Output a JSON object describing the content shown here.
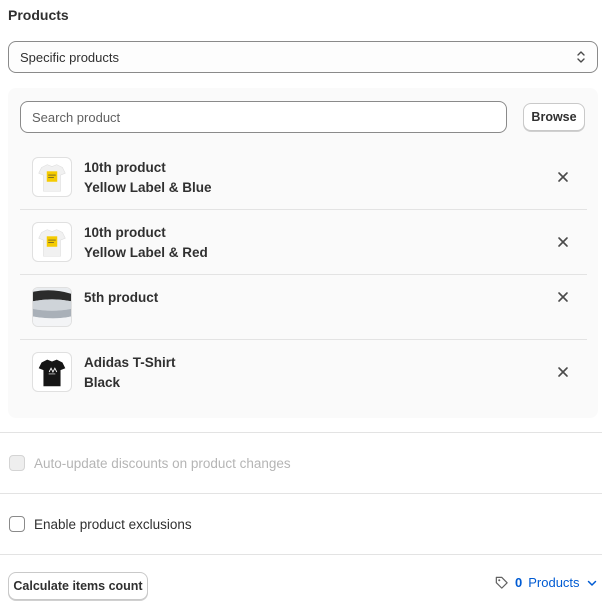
{
  "section": {
    "title": "Products"
  },
  "applies_to": {
    "selected": "Specific products"
  },
  "search": {
    "placeholder": "Search product",
    "browse_label": "Browse"
  },
  "products": [
    {
      "name": "10th product",
      "variant": "Yellow Label & Blue",
      "thumb": "white-tshirt-yellow-label"
    },
    {
      "name": "10th product",
      "variant": "Yellow Label & Red",
      "thumb": "white-tshirt-yellow-label"
    },
    {
      "name": "5th product",
      "variant": "",
      "thumb": "folded-fabric"
    },
    {
      "name": "Adidas T-Shirt",
      "variant": "Black",
      "thumb": "black-tshirt"
    }
  ],
  "options": {
    "auto_update": {
      "label": "Auto-update discounts on product changes",
      "checked": false,
      "disabled": true
    },
    "exclusions": {
      "label": "Enable product exclusions",
      "checked": false,
      "disabled": false
    }
  },
  "footer": {
    "calculate_label": "Calculate items count",
    "count_value": "0",
    "count_label": "Products"
  },
  "colors": {
    "link": "#005bd3",
    "text": "#303030",
    "muted": "#b5b5b5"
  }
}
